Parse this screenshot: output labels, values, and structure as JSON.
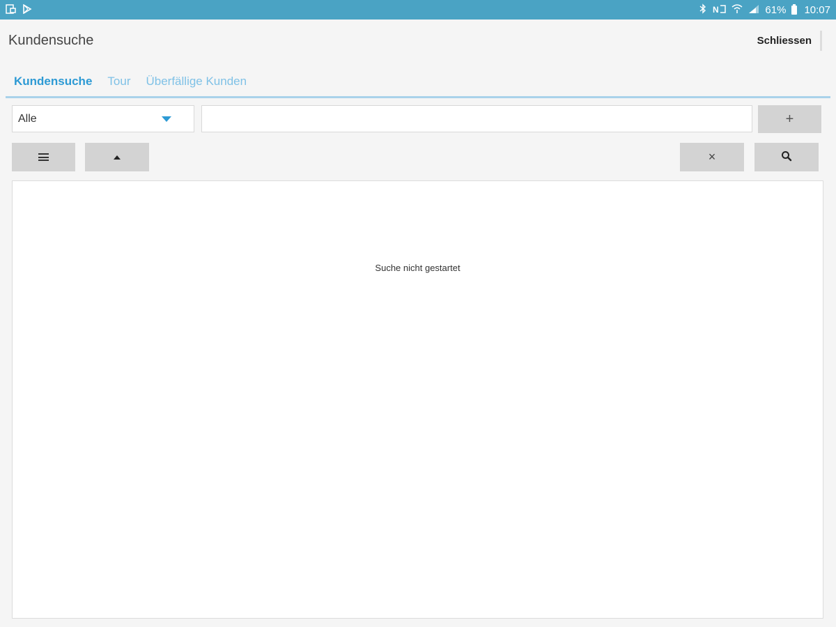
{
  "status_bar": {
    "left_icons": [
      "gallery-icon",
      "play-store-icon"
    ],
    "right_icons": [
      "bluetooth-icon",
      "nfc-icon",
      "wifi-icon",
      "signal-icon",
      "battery-icon"
    ],
    "battery_percent": "61%",
    "time": "10:07",
    "color": "#4aa3c4"
  },
  "header": {
    "title": "Kundensuche",
    "close_label": "Schliessen"
  },
  "tabs": [
    {
      "label": "Kundensuche",
      "active": true
    },
    {
      "label": "Tour",
      "active": false
    },
    {
      "label": "Überfällige Kunden",
      "active": false
    }
  ],
  "accent_color": "#2d9ad4",
  "filter": {
    "select_value": "Alle",
    "search_value": "",
    "add_label": "+"
  },
  "toolbar": {
    "menu_icon": "menu-icon",
    "up_icon": "arrow-up-icon",
    "clear_label": "×",
    "search_icon": "search-icon"
  },
  "results": {
    "message": "Suche nicht gestartet"
  }
}
